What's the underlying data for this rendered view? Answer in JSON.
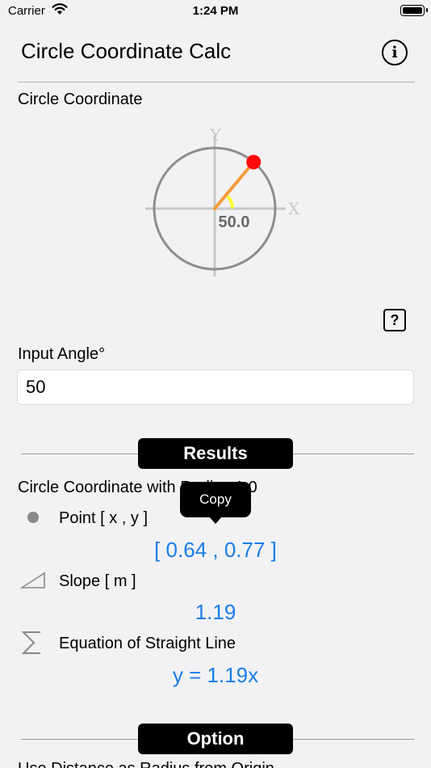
{
  "status_bar": {
    "carrier": "Carrier",
    "time": "1:24 PM"
  },
  "header": {
    "title": "Circle Coordinate Calc",
    "info_icon": "info-icon"
  },
  "diagram": {
    "section_label": "Circle Coordinate",
    "axis_x_label": "X",
    "axis_y_label": "Y",
    "angle_label": "50.0",
    "angle_degrees": 50,
    "colors": {
      "circle": "#8e8e8e",
      "radius_line": "#f39a3b",
      "point": "#ff0a0a",
      "angle_arc": "#ffff33",
      "axes": "#c8c8c8"
    }
  },
  "help_button": {
    "label": "?"
  },
  "input": {
    "label": "Input Angle°",
    "value": "50"
  },
  "results": {
    "header": "Results",
    "subtitle": "Circle Coordinate with Radius 1.0",
    "copy_tooltip": "Copy",
    "point": {
      "icon": "dot-icon",
      "label": "Point [ x , y ]",
      "value": "[ 0.64 , 0.77 ]"
    },
    "slope": {
      "icon": "slope-triangle-icon",
      "label": "Slope [ m ]",
      "value": "1.19"
    },
    "equation": {
      "icon": "sigma-icon",
      "label": "Equation of Straight Line",
      "value": "y = 1.19x"
    },
    "accent_color": "#1a7ee6"
  },
  "option": {
    "header": "Option",
    "partial_row": "Use Distance as Radius from Origin"
  }
}
